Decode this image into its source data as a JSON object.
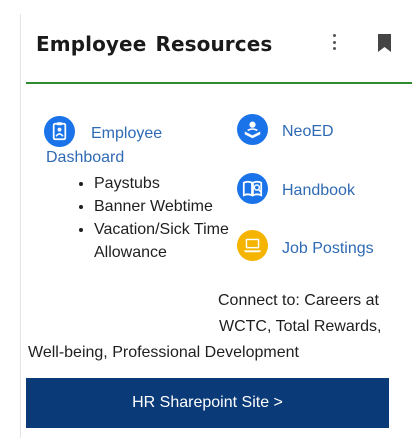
{
  "header": {
    "title": "Employee Resources",
    "menu_icon": "more-vertical-icon",
    "bookmark_icon": "bookmark-icon"
  },
  "links": {
    "employee_dashboard": "Employee Dashboard",
    "neoed": "NeoED",
    "handbook": "Handbook",
    "job_postings": "Job Postings"
  },
  "dashboard_items": [
    "Paystubs",
    "Banner Webtime",
    "Vacation/Sick Time Allowance"
  ],
  "connect": {
    "line1": "Connect to: Careers at",
    "line2": "WCTC, Total Rewards,",
    "line3": "Well-being, Professional Development"
  },
  "button": {
    "label": "HR Sharepoint Site >"
  },
  "colors": {
    "accent_green": "#2e8b2e",
    "link_blue": "#2f6ab4",
    "icon_blue": "#1a73e8",
    "icon_yellow": "#f4b400",
    "button_navy": "#0a3a78"
  }
}
